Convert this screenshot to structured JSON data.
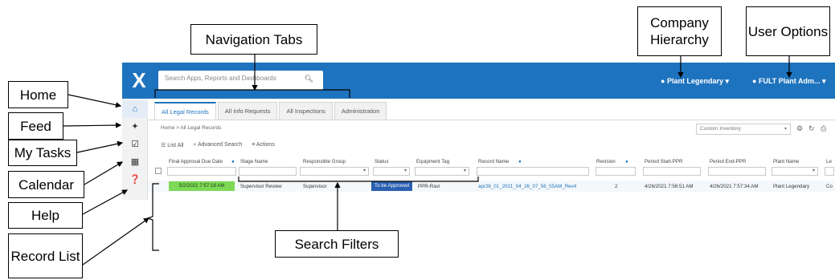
{
  "app": {
    "search_placeholder": "Search Apps, Reports and Dashboards",
    "company_hierarchy": "Plant Legendary",
    "user_options": "FULT Plant Adm...",
    "accent_color": "#1e73be"
  },
  "tabs": [
    "All Legal Records",
    "All Info Requests",
    "All Inspections",
    "Administration"
  ],
  "breadcrumb": "Home > All Legal Records",
  "inventory_select": "Custom Inventory",
  "actions": {
    "list_all": "List All",
    "advanced_search": "Advanced Search",
    "actions": "Actions"
  },
  "table": {
    "columns": [
      "Final Approval Due Date",
      "Stage Name",
      "Responsible Group",
      "Status",
      "Equipment Tag",
      "Record Name",
      "Revision",
      "Period Start-PPR",
      "Period End-PPR",
      "Plant Name",
      "Le"
    ],
    "row": {
      "due_date": "5/2/2021 7:57:18 AM",
      "stage": "Supervisor Review",
      "group": "Supervisor",
      "status": "To be Approved",
      "equipment": "PPR-Ravi",
      "record_name": "apr26_01_2021_04_26_07_56_55AM_Rev4",
      "revision": "2",
      "period_start": "4/26/2021 7:56:51 AM",
      "period_end": "4/26/2021 7:57:34 AM",
      "plant": "Plant Legendary",
      "le": "Co"
    },
    "due_color": "#7ed957",
    "status_color": "#2a5fb0"
  },
  "callouts": {
    "navigation_tabs": "Navigation Tabs",
    "company_hierarchy": "Company Hierarchy",
    "user_options": "User Options",
    "home": "Home",
    "feed": "Feed",
    "my_tasks": "My Tasks",
    "calendar": "Calendar",
    "help": "Help",
    "record_list": "Record List",
    "search_filters": "Search Filters"
  }
}
